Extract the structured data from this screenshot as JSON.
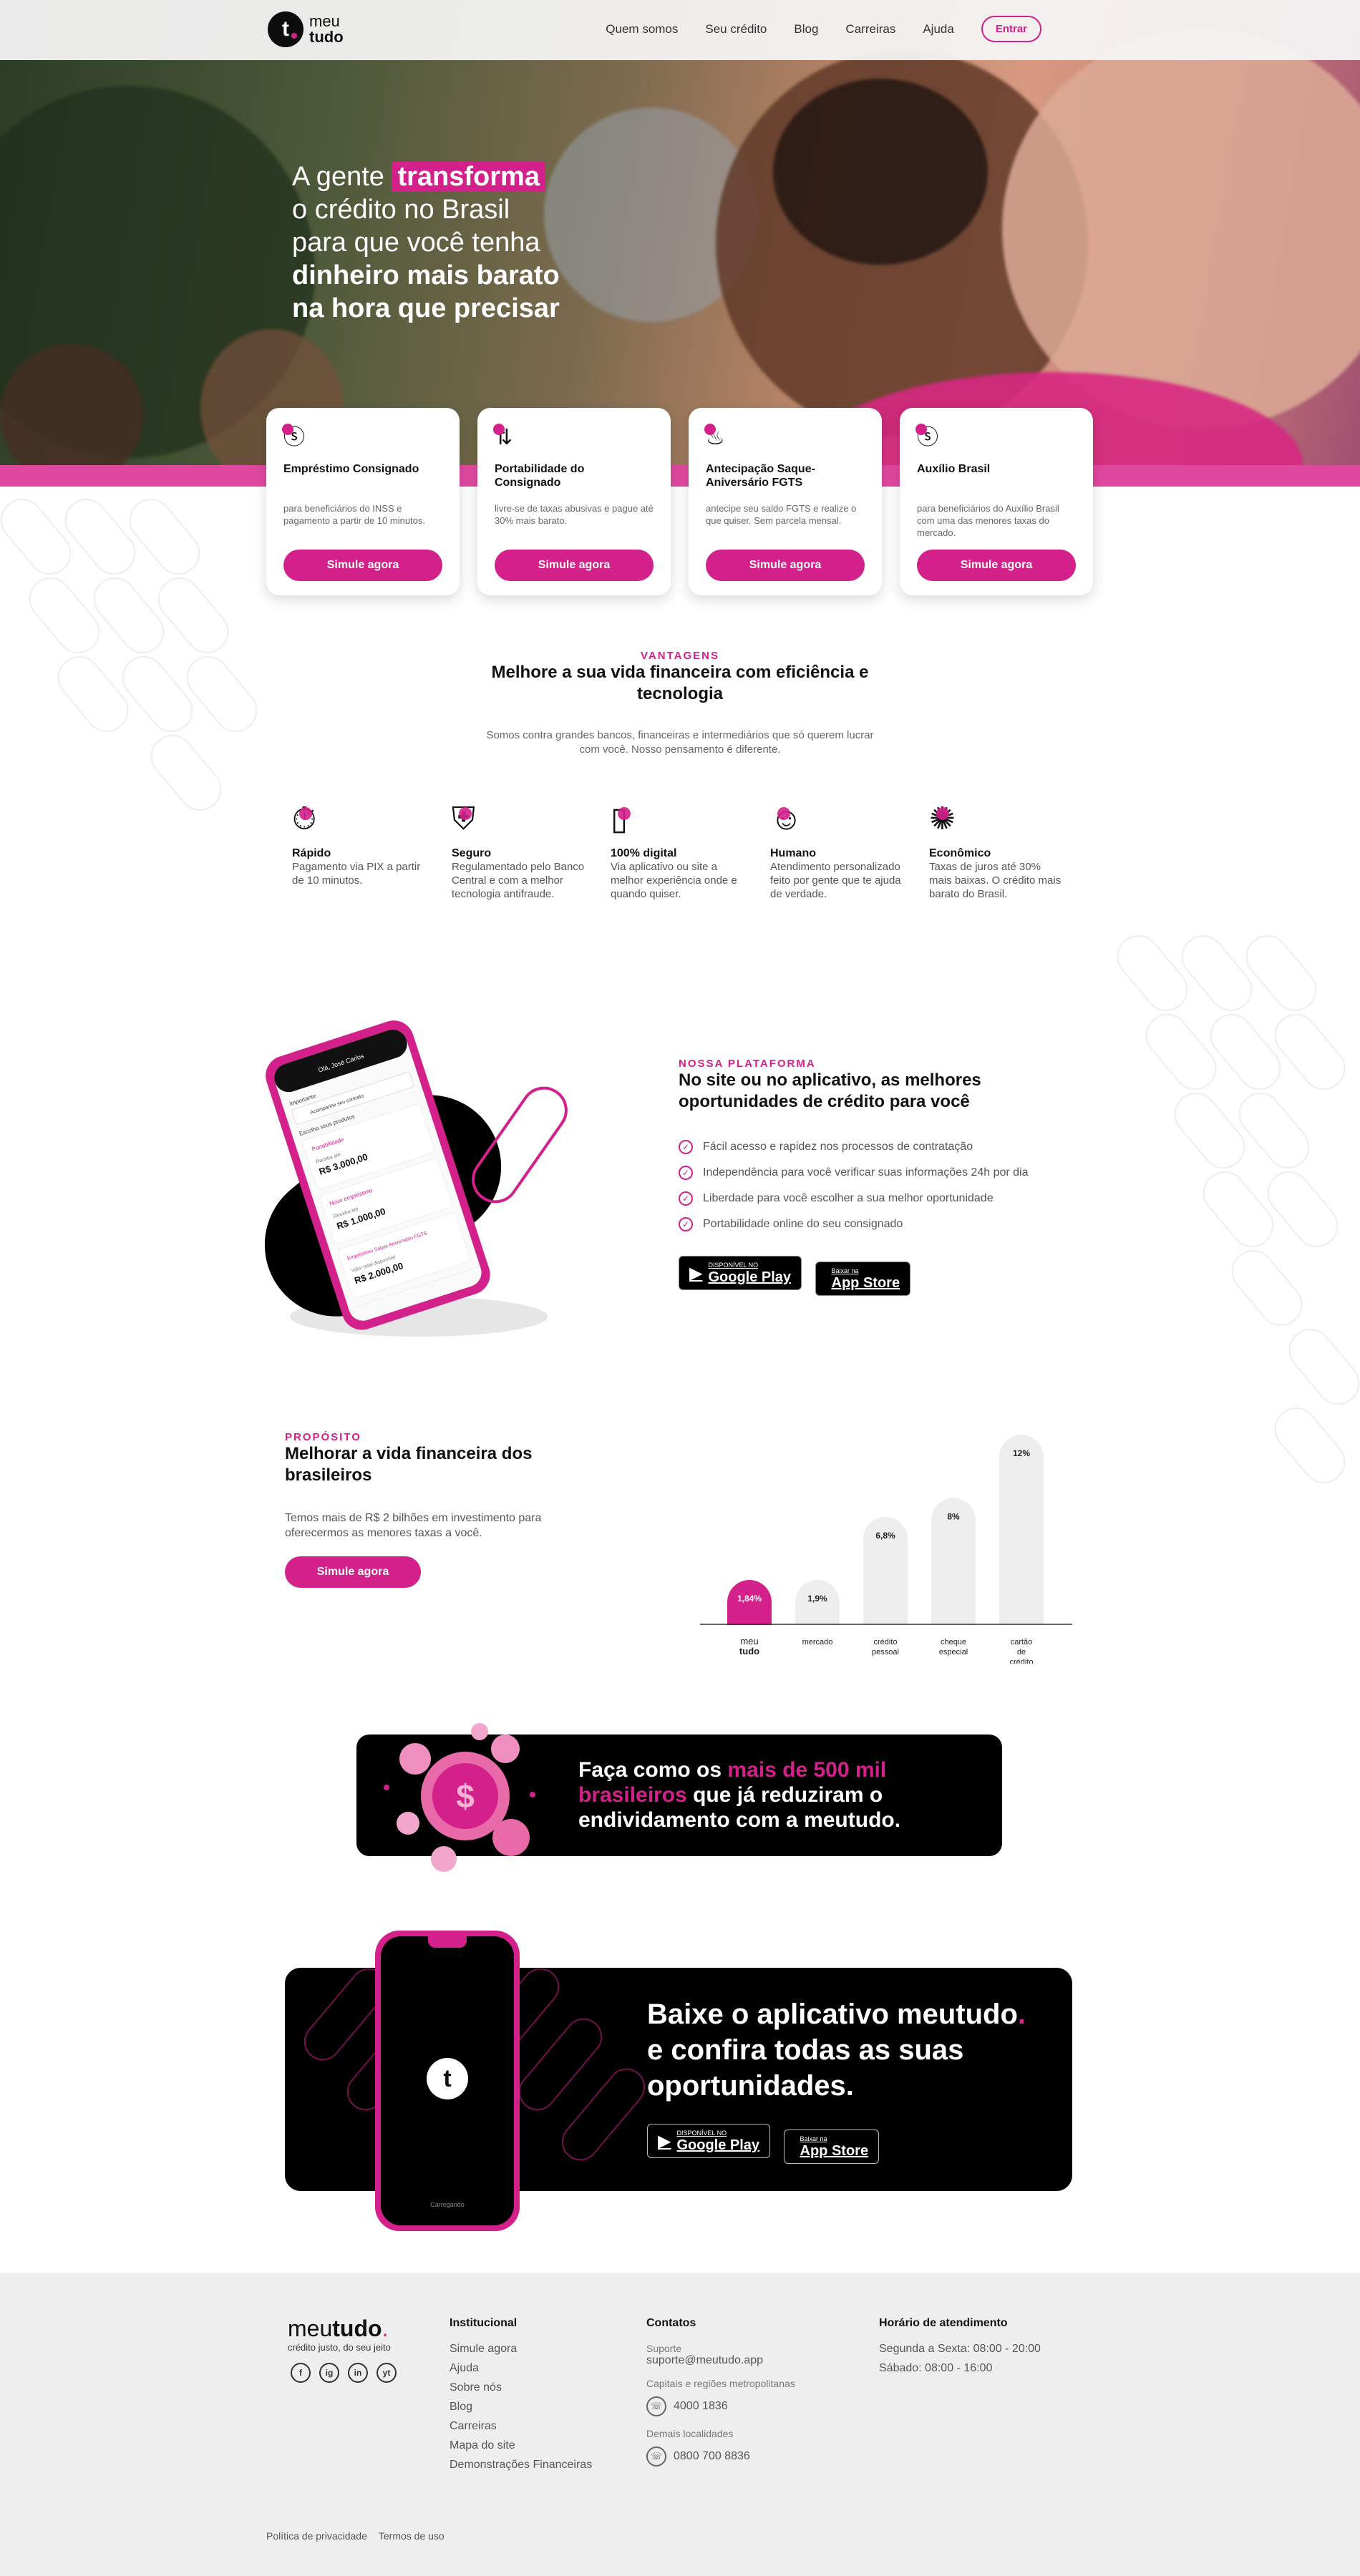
{
  "brand": {
    "logo_top": "meu",
    "logo_bottom": "tudo",
    "pink": "#d3208b"
  },
  "nav": {
    "items": [
      "Quem somos",
      "Seu crédito",
      "Blog",
      "Carreiras",
      "Ajuda"
    ],
    "cta": "Entrar"
  },
  "hero": {
    "l1a": "A gente ",
    "l1b": "transforma",
    "l2": "o crédito no Brasil",
    "l3": "para que você tenha",
    "l4": "dinheiro mais barato",
    "l5": "na hora que precisar"
  },
  "products": [
    {
      "icon": "dollar-circle-icon",
      "title": "Empréstimo Consignado",
      "desc": "para beneficiários do INSS e pagamento a partir de 10 minutos.",
      "cta": "Simule agora"
    },
    {
      "icon": "transfer-icon",
      "title": "Portabilidade do Consignado",
      "desc": "livre-se de taxas abusivas e pague até 30% mais barato.",
      "cta": "Simule agora"
    },
    {
      "icon": "cake-icon",
      "title": "Antecipação Saque-Aniversário FGTS",
      "desc": "antecipe seu saldo FGTS e realize o que quiser. Sem parcela mensal.",
      "cta": "Simule agora"
    },
    {
      "icon": "dollar-circle-icon",
      "title": "Auxílio Brasil",
      "desc": "para beneficiários do Auxílio Brasil com uma das menores taxas do mercado.",
      "cta": "Simule agora"
    }
  ],
  "vantagens": {
    "eyebrow": "VANTAGENS",
    "title": "Melhore a sua vida financeira com eficiência e tecnologia",
    "subtitle": "Somos contra grandes bancos, financeiras e intermediários que só querem lucrar com você. Nosso pensamento é diferente.",
    "features": [
      {
        "icon": "stopwatch-icon",
        "title": "Rápido",
        "desc": "Pagamento via PIX a partir de 10 minutos."
      },
      {
        "icon": "shield-lock-icon",
        "title": "Seguro",
        "desc": "Regulamentado pelo Banco Central e com a melhor tecnologia antifraude."
      },
      {
        "icon": "smartphone-icon",
        "title": "100% digital",
        "desc": "Via aplicativo ou site a melhor experiência onde e quando quiser."
      },
      {
        "icon": "smiley-icon",
        "title": "Humano",
        "desc": "Atendimento personalizado feito por gente que te ajuda de verdade."
      },
      {
        "icon": "percent-badge-icon",
        "title": "Econômico",
        "desc": "Taxas de juros até 30% mais baixas. O crédito mais barato do Brasil."
      }
    ]
  },
  "plataforma": {
    "eyebrow": "NOSSA PLATAFORMA",
    "title": "No site ou no aplicativo, as melhores oportunidades de crédito para você",
    "checks": [
      "Fácil acesso e rapidez nos processos de contratação",
      "Independência para você verificar suas informações 24h por dia",
      "Liberdade para você escolher a sua melhor oportunidade",
      "Portabilidade online do seu consignado"
    ],
    "phone": {
      "greeting": "Olá, José Carlos",
      "importante": "Importante",
      "acompanhe": "Acompanhe seu contrato",
      "escolha": "Escolha seus produtos",
      "items": [
        {
          "name": "Portabilidade",
          "label": "Receba até",
          "value": "R$ 3.000,00"
        },
        {
          "name": "Novo empréstimo",
          "label": "Receba até",
          "value": "R$ 1.000,00"
        },
        {
          "name": "Empréstimo Saque Aniversário FGTS",
          "label": "Valor total disponível",
          "value": "R$ 2.000,00"
        }
      ]
    }
  },
  "stores": {
    "google_small": "DISPONÍVEL NO",
    "google": "Google Play",
    "apple_small": "Baixar na",
    "apple": "App Store"
  },
  "proposito": {
    "eyebrow": "PROPÓSITO",
    "title": "Melhorar a vida financeira dos brasileiros",
    "desc": "Temos mais de R$ 2 bilhões em investimento para oferecermos as menores taxas a você.",
    "cta": "Simule agora"
  },
  "chart_data": {
    "type": "bar",
    "categories": [
      "meu tudo",
      "mercado",
      "crédito pessoal",
      "cheque especial",
      "cartão de crédito"
    ],
    "values": [
      1.84,
      1.9,
      6.8,
      8,
      12
    ],
    "labels": [
      "1,84%",
      "1,9%",
      "6,8%",
      "8%",
      "12%"
    ],
    "highlight_color": "#d3208b",
    "bar_color": "#eeeeee"
  },
  "banner": {
    "t1": "Faça como os ",
    "t2": "mais de 500 mil brasileiros",
    "t3": " que já reduziram o endividamento com a meutudo."
  },
  "app": {
    "t1": "Baixe o aplicativo meutudo",
    "dot": ".",
    "t2": " e confira todas as suas oportunidades.",
    "loading": "Carregando"
  },
  "footer": {
    "logo_a": "meu",
    "logo_b": "tudo",
    "logo_dot": ".",
    "tagline": "crédito justo, do seu jeito",
    "social": [
      "f",
      "ig",
      "in",
      "yt"
    ],
    "institucional": {
      "title": "Institucional",
      "links": [
        "Simule agora",
        "Ajuda",
        "Sobre nós",
        "Blog",
        "Carreiras",
        "Mapa do site",
        "Demonstrações Financeiras"
      ]
    },
    "contatos": {
      "title": "Contatos",
      "support_label": "Suporte",
      "support_email": "suporte@meutudo.app",
      "capitais_label": "Capitais e regiões metropolitanas",
      "capitais_phone": "4000 1836",
      "demais_label": "Demais localidades",
      "demais_phone": "0800 700 8836"
    },
    "horario": {
      "title": "Horário de atendimento",
      "l1": "Segunda a Sexta: 08:00 - 20:00",
      "l2": "Sábado: 08:00 - 16:00"
    },
    "legal": [
      "Política de privacidade",
      "Termos de uso"
    ]
  }
}
